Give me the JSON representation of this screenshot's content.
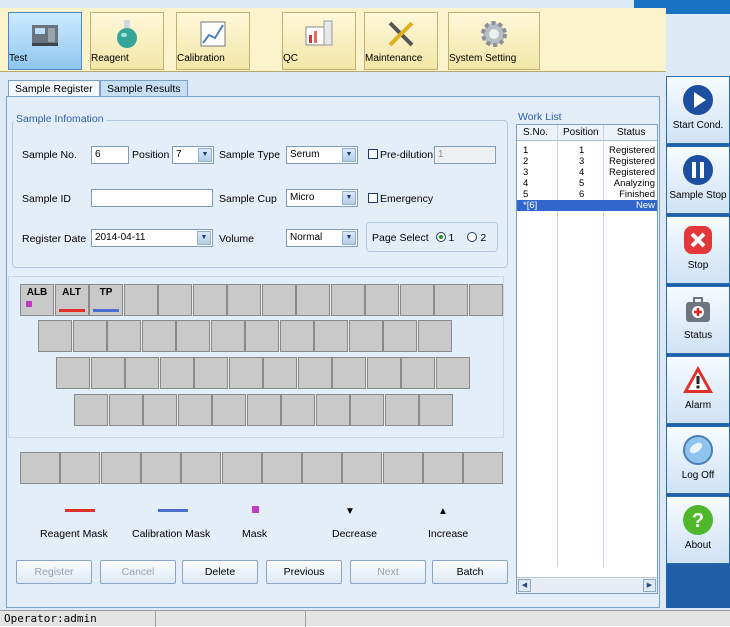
{
  "toolbar": {
    "items": [
      {
        "label": "Test",
        "icon": "test-analyzer-icon"
      },
      {
        "label": "Reagent",
        "icon": "reagent-flask-icon"
      },
      {
        "label": "Calibration",
        "icon": "calibration-chart-icon"
      },
      {
        "label": "QC",
        "icon": "qc-chart-icon"
      },
      {
        "label": "Maintenance",
        "icon": "tools-icon"
      },
      {
        "label": "System Setting",
        "icon": "gear-icon"
      }
    ]
  },
  "tabs": [
    "Sample Register",
    "Sample Results"
  ],
  "sample_info": {
    "title": "Sample Infomation",
    "sample_no_label": "Sample No.",
    "sample_no_value": "6",
    "position_label": "Position",
    "position_value": "7",
    "sample_type_label": "Sample Type",
    "sample_type_value": "Serum",
    "predilution_label": "Pre-dilution",
    "predilution_value": "1",
    "sample_id_label": "Sample ID",
    "sample_id_value": "",
    "sample_cup_label": "Sample Cup",
    "sample_cup_value": "Micro",
    "emergency_label": "Emergency",
    "register_date_label": "Register Date",
    "register_date_value": "2014-04-11",
    "volume_label": "Volume",
    "volume_value": "Normal",
    "page_select_label": "Page Select",
    "page_options": [
      "1",
      "2"
    ],
    "page_selected": "1"
  },
  "keyboard": {
    "row1_keys": [
      "ALB",
      "ALT",
      "TP",
      "",
      "",
      "",
      "",
      "",
      "",
      "",
      "",
      "",
      "",
      ""
    ],
    "key_marks": {
      "ALB": "mask",
      "ALT": "reagent",
      "TP": "calibration"
    },
    "colors": {
      "reagent_mask": "#e0302a",
      "calibration_mask": "#4a6fd0",
      "mask": "#c23ac6"
    }
  },
  "legend": {
    "reagent_mask": "Reagent Mask",
    "calibration_mask": "Calibration Mask",
    "mask": "Mask",
    "decrease": "Decrease",
    "decrease_symbol": "▼",
    "increase": "Increase",
    "increase_symbol": "▲"
  },
  "actions": {
    "register": "Register",
    "cancel": "Cancel",
    "delete": "Delete",
    "previous": "Previous",
    "next": "Next",
    "batch": "Batch"
  },
  "worklist": {
    "title": "Work List",
    "headers": [
      "S.No.",
      "Position",
      "Status"
    ],
    "rows": [
      {
        "sno": "1",
        "pos": "1",
        "status": "Registered"
      },
      {
        "sno": "2",
        "pos": "3",
        "status": "Registered"
      },
      {
        "sno": "3",
        "pos": "4",
        "status": "Registered"
      },
      {
        "sno": "4",
        "pos": "5",
        "status": "Analyzing"
      },
      {
        "sno": "5",
        "pos": "6",
        "status": "Finished"
      },
      {
        "sno": "*[6]",
        "pos": "",
        "status": "New"
      }
    ]
  },
  "side_panel": {
    "items": [
      {
        "label": "Start Cond.",
        "icon": "play-icon"
      },
      {
        "label": "Sample Stop",
        "icon": "pause-icon"
      },
      {
        "label": "Stop",
        "icon": "stop-x-icon"
      },
      {
        "label": "Status",
        "icon": "first-aid-kit-icon"
      },
      {
        "label": "Alarm",
        "icon": "warning-icon"
      },
      {
        "label": "Log Off",
        "icon": "logoff-icon"
      },
      {
        "label": "About",
        "icon": "help-icon"
      }
    ]
  },
  "status_bar": {
    "operator": "Operator:admin"
  }
}
